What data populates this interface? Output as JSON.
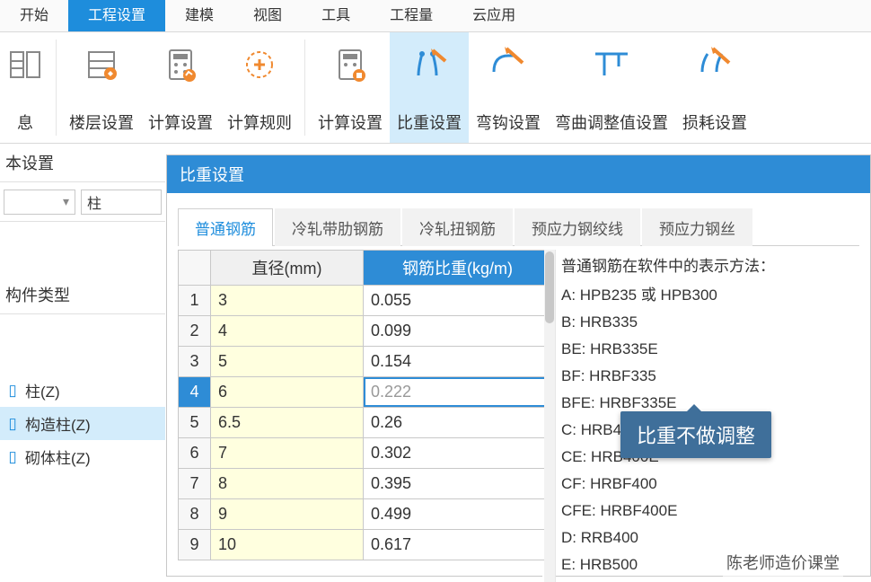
{
  "menu": {
    "items": [
      "开始",
      "工程设置",
      "建模",
      "视图",
      "工具",
      "工程量",
      "云应用"
    ],
    "active_index": 1
  },
  "ribbon": {
    "buttons": [
      {
        "id": "basic-info",
        "label": "息",
        "narrow": true
      },
      {
        "id": "floor",
        "label": "楼层设置"
      },
      {
        "id": "calc",
        "label": "计算设置"
      },
      {
        "id": "calc-rule",
        "label": "计算规则"
      },
      {
        "id": "calc2",
        "label": "计算设置"
      },
      {
        "id": "weight",
        "label": "比重设置",
        "active": true
      },
      {
        "id": "hook",
        "label": "弯钩设置"
      },
      {
        "id": "bend-adj",
        "label": "弯曲调整值设置"
      },
      {
        "id": "loss",
        "label": "损耗设置"
      }
    ]
  },
  "left": {
    "section1_label": "本设置",
    "dropdown_value": "柱",
    "section2_label": "构件类型",
    "tree": [
      {
        "icon": "column-icon",
        "label": "柱(Z)"
      },
      {
        "icon": "constr-icon",
        "label": "构造柱(Z)",
        "active": true
      },
      {
        "icon": "masonry-icon",
        "label": "砌体柱(Z)"
      }
    ]
  },
  "dialog": {
    "title": "比重设置",
    "tabs": [
      "普通钢筋",
      "冷轧带肋钢筋",
      "冷轧扭钢筋",
      "预应力钢绞线",
      "预应力钢丝"
    ],
    "active_tab": 0,
    "table": {
      "headers": {
        "index": "",
        "diameter": "直径(mm)",
        "weight": "钢筋比重(kg/m)"
      },
      "rows": [
        {
          "idx": "1",
          "diameter": "3",
          "weight": "0.055"
        },
        {
          "idx": "2",
          "diameter": "4",
          "weight": "0.099"
        },
        {
          "idx": "3",
          "diameter": "5",
          "weight": "0.154"
        },
        {
          "idx": "4",
          "diameter": "6",
          "weight": "0.222",
          "editing": true
        },
        {
          "idx": "5",
          "diameter": "6.5",
          "weight": "0.26"
        },
        {
          "idx": "6",
          "diameter": "7",
          "weight": "0.302"
        },
        {
          "idx": "7",
          "diameter": "8",
          "weight": "0.395"
        },
        {
          "idx": "8",
          "diameter": "9",
          "weight": "0.499"
        },
        {
          "idx": "9",
          "diameter": "10",
          "weight": "0.617"
        }
      ],
      "selected_row": 3
    },
    "info": {
      "title": "普通钢筋在软件中的表示方法：",
      "lines": [
        "A:   HPB235 或 HPB300",
        "B:   HRB335",
        "BE:  HRB335E",
        "BF:  HRBF335",
        "BFE: HRBF335E",
        "C:   HRB400",
        "CE:  HRB400E",
        "CF:  HRBF400",
        "CFE: HRBF400E",
        "D:   RRB400",
        "E:   HRB500"
      ]
    },
    "callout_text": "比重不做调整",
    "watermark": "陈老师造价课堂"
  },
  "chart_data": {
    "type": "table",
    "title": "比重设置 — 普通钢筋",
    "columns": [
      "直径(mm)",
      "钢筋比重(kg/m)"
    ],
    "rows": [
      [
        3,
        0.055
      ],
      [
        4,
        0.099
      ],
      [
        5,
        0.154
      ],
      [
        6,
        0.222
      ],
      [
        6.5,
        0.26
      ],
      [
        7,
        0.302
      ],
      [
        8,
        0.395
      ],
      [
        9,
        0.499
      ],
      [
        10,
        0.617
      ]
    ]
  }
}
